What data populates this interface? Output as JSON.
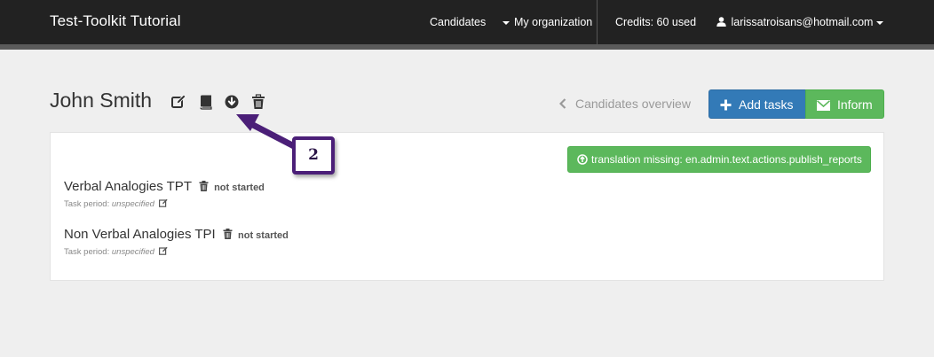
{
  "navbar": {
    "brand": "Test-Toolkit Tutorial",
    "candidates": "Candidates",
    "organization": "My organization",
    "credits": "Credits: 60 used",
    "user_email": "larissatroisans@hotmail.com"
  },
  "header": {
    "title": "John Smith",
    "icons": [
      "edit-icon",
      "book-icon",
      "download-icon",
      "trash-icon"
    ],
    "overview_link": "Candidates overview",
    "add_tasks": "Add tasks",
    "inform": "Inform"
  },
  "panel": {
    "publish_button": "translation missing: en.admin.text.actions.publish_reports",
    "tasks": [
      {
        "name": "Verbal Analogies TPT",
        "status": "not started",
        "period_label": "Task period:",
        "period_value": "unspecified"
      },
      {
        "name": "Non Verbal Analogies TPI",
        "status": "not started",
        "period_label": "Task period:",
        "period_value": "unspecified"
      }
    ]
  },
  "annotation": {
    "label": "2",
    "color": "#4b1f78"
  },
  "colors": {
    "navbar": "#222222",
    "primary": "#337ab7",
    "success": "#5cb85c",
    "background": "#efefef"
  }
}
